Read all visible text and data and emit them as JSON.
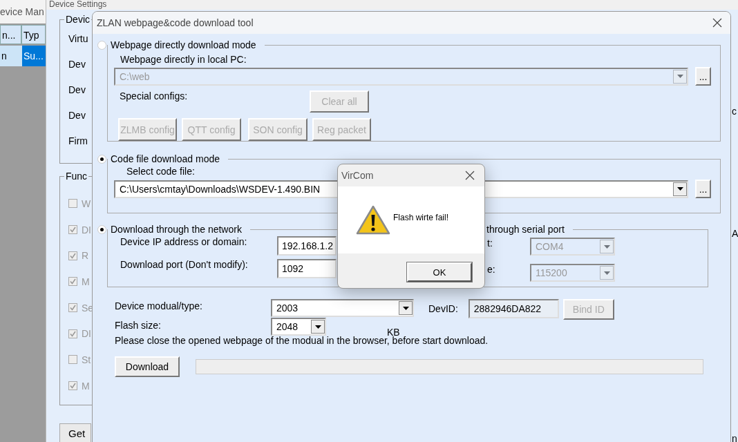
{
  "device_manager": {
    "title": "evice Man",
    "columns": [
      "n...",
      "Typ"
    ],
    "rows": [
      {
        "cells": [
          "n",
          "Su..."
        ],
        "selected": true
      }
    ]
  },
  "device_settings": {
    "title": "Device Settings",
    "info_group": {
      "legend": "Devic",
      "fields": [
        "Virtu",
        "Dev",
        "Dev",
        "Dev",
        "Firm"
      ]
    },
    "function_group": {
      "legend": "Func",
      "options": [
        {
          "label": "W",
          "checked": false
        },
        {
          "label": "DI",
          "checked": true
        },
        {
          "label": "R",
          "checked": true
        },
        {
          "label": "M",
          "checked": true
        },
        {
          "label": "Se",
          "checked": true
        },
        {
          "label": "DI",
          "checked": true
        },
        {
          "label": "St",
          "checked": false
        },
        {
          "label": "M",
          "checked": true
        }
      ]
    },
    "button": "Get",
    "edge_texts": [
      "c",
      "A",
      "n"
    ]
  },
  "tool": {
    "title": "ZLAN webpage&code download tool",
    "webpage_mode": {
      "label": "Webpage directly download mode",
      "selected": false,
      "path_label": "Webpage directly in local PC:",
      "path": "C:\\web",
      "browse": "...",
      "special_label": "Special configs:",
      "clear_button": "Clear all",
      "config_buttons": [
        "ZLMB config",
        "QTT config",
        "SON config",
        "Reg packet"
      ]
    },
    "code_mode": {
      "label": "Code file download mode",
      "selected": true,
      "file_label": "Select code file:",
      "file": "C:\\Users\\cmtay\\Downloads\\WSDEV-1.490.BIN",
      "browse": "..."
    },
    "network": {
      "label": "Download through the network",
      "selected": true,
      "ip_label": "Device IP address or domain:",
      "ip": "192.168.1.2",
      "port_label": "Download port (Don't modify):",
      "port": "1092"
    },
    "serial": {
      "label": "through serial port",
      "port_label": "t:",
      "port": "COM4",
      "baud_label": "e:",
      "baud": "115200"
    },
    "module_label": "Device modual/type:",
    "module": "2003",
    "devid_label": "DevID:",
    "devid": "2882946DA822",
    "bind_button": "Bind ID",
    "flash_label": "Flash size:",
    "flash": "2048",
    "flash_unit": "KB",
    "note": "Please close the opened webpage of the modual in the browser, before start download.",
    "download_button": "Download",
    "progress": {
      "level": 0
    }
  },
  "dialog": {
    "title": "VirCom",
    "message": "Flash wirte fail!",
    "ok_button": "OK"
  }
}
